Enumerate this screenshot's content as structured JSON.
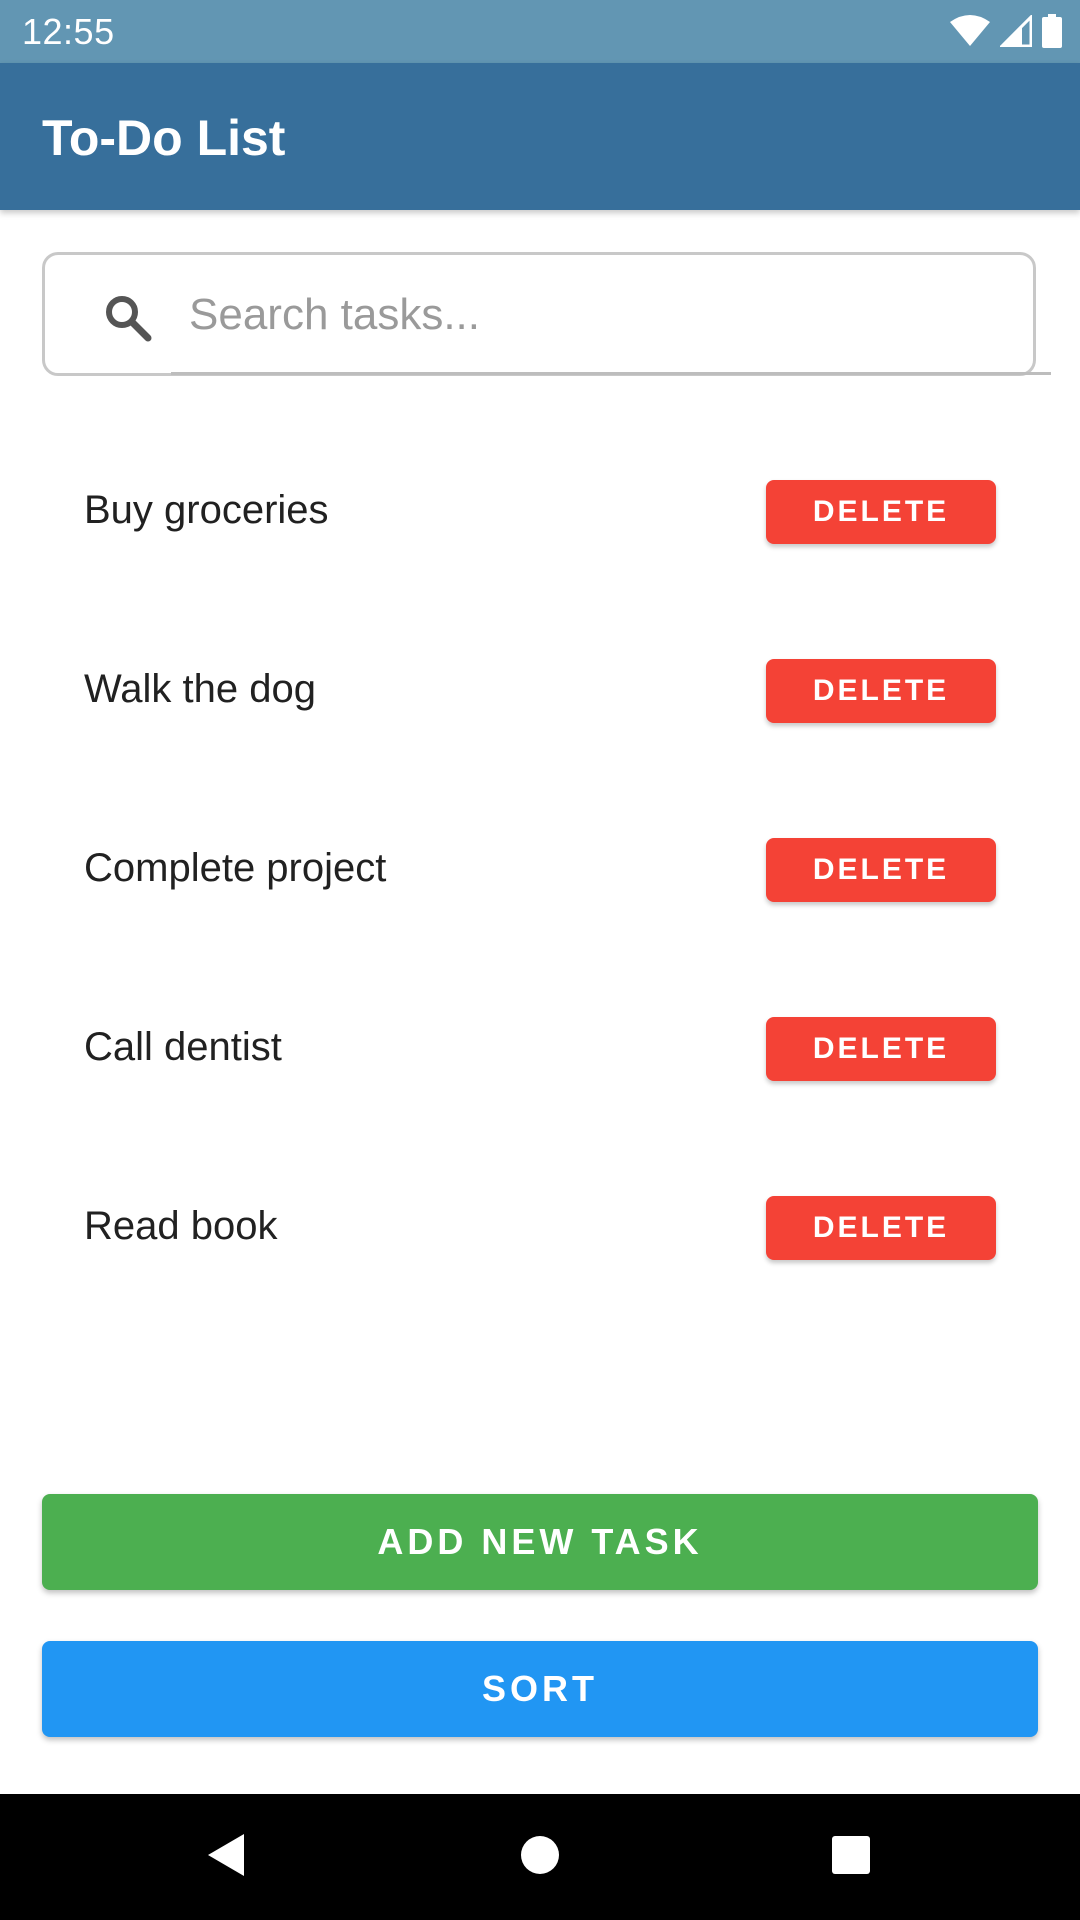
{
  "status_bar": {
    "time": "12:55",
    "icons": [
      "wifi-icon",
      "cell-signal-icon",
      "battery-icon"
    ]
  },
  "app_bar": {
    "title": "To-Do List",
    "color": "#376F9B"
  },
  "search": {
    "placeholder": "Search tasks...",
    "value": "",
    "icon": "search-icon"
  },
  "tasks": [
    {
      "label": "Buy groceries",
      "delete_label": "DELETE"
    },
    {
      "label": "Walk the dog",
      "delete_label": "DELETE"
    },
    {
      "label": "Complete project",
      "delete_label": "DELETE"
    },
    {
      "label": "Call dentist",
      "delete_label": "DELETE"
    },
    {
      "label": "Read book",
      "delete_label": "DELETE"
    }
  ],
  "actions": {
    "add_label": "ADD NEW TASK",
    "sort_label": "SORT"
  },
  "colors": {
    "status_bar": "#6296B3",
    "delete": "#F44236",
    "add": "#4CAF50",
    "sort": "#2196F3"
  },
  "nav_bar": {
    "icons": [
      "back-icon",
      "home-icon",
      "recents-icon"
    ]
  }
}
